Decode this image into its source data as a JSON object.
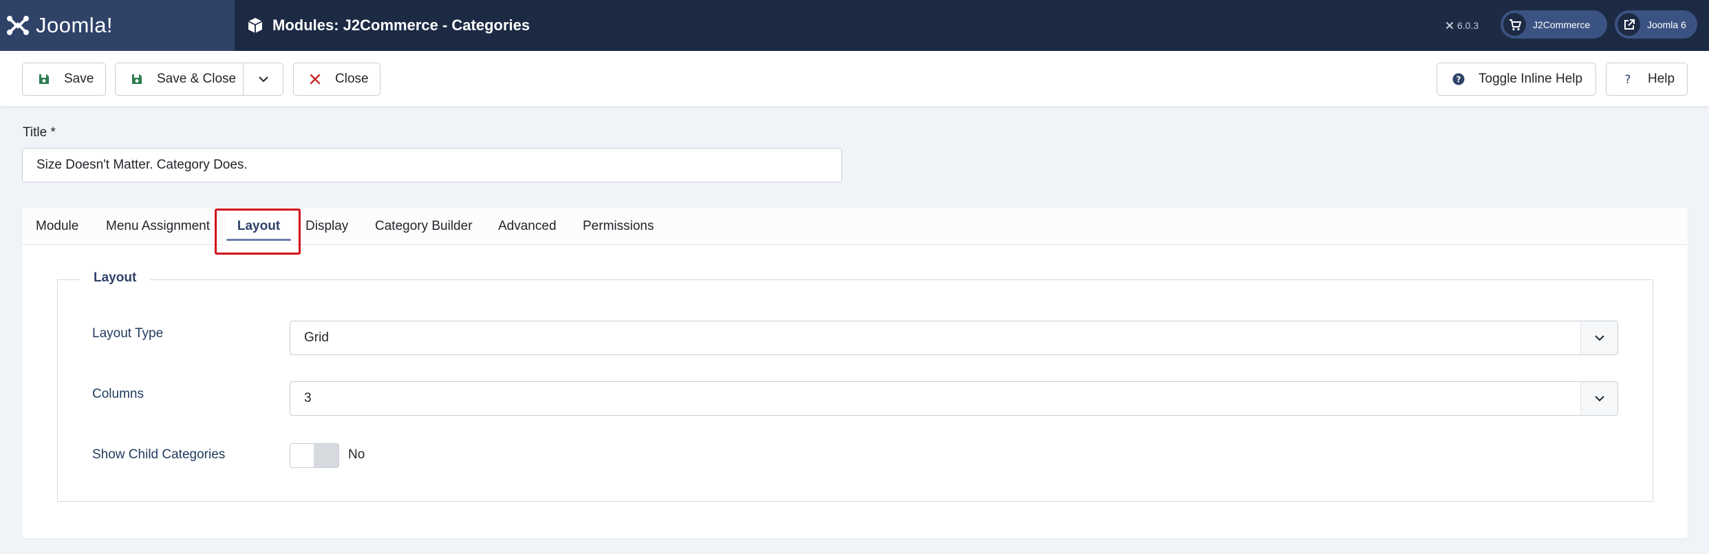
{
  "header": {
    "brand": "Joomla!",
    "title": "Modules: J2Commerce - Categories",
    "version": "6.0.3",
    "store_label": "J2Commerce",
    "site_label": "Joomla 6"
  },
  "toolbar": {
    "save": "Save",
    "save_close": "Save & Close",
    "close": "Close",
    "toggle_help": "Toggle Inline Help",
    "help": "Help"
  },
  "form": {
    "title_label": "Title *",
    "title_value": "Size Doesn't Matter. Category Does."
  },
  "tabs": {
    "module": "Module",
    "menu_assignment": "Menu Assignment",
    "layout": "Layout",
    "display": "Display",
    "category_builder": "Category Builder",
    "advanced": "Advanced",
    "permissions": "Permissions"
  },
  "layout_section": {
    "legend": "Layout",
    "layout_type_label": "Layout Type",
    "layout_type_value": "Grid",
    "columns_label": "Columns",
    "columns_value": "3",
    "child_categories_label": "Show Child Categories",
    "child_categories_value": "No"
  },
  "colors": {
    "header_bg": "#1c2a44",
    "brand_bg": "#2f4268",
    "accent": "#2f4268",
    "close_icon": "#c52827",
    "highlight": "#d0101a"
  },
  "icons": {
    "brand": "joomla-logo-icon",
    "page": "cube-icon",
    "store": "shopping-cart-icon",
    "site": "external-link-icon",
    "save": "floppy-disk-icon",
    "close": "x-mark-icon",
    "help_toggle": "question-circle-icon",
    "help": "question-mark-icon",
    "dropdown": "chevron-down-icon"
  }
}
